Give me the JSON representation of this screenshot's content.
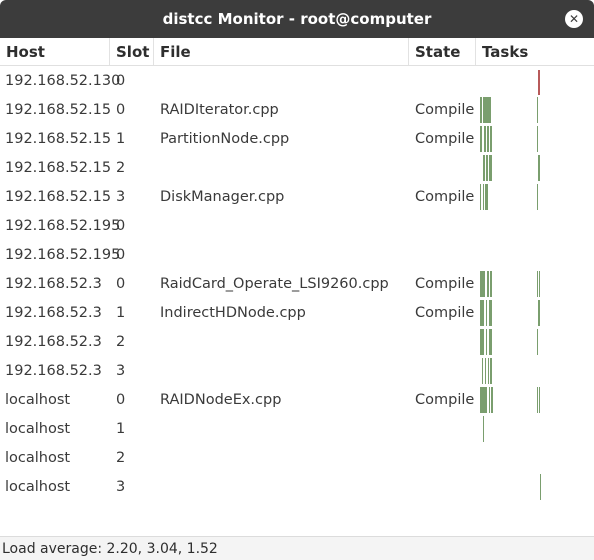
{
  "window": {
    "title": "distcc Monitor - root@computer"
  },
  "columns": {
    "host": "Host",
    "slot": "Slot",
    "file": "File",
    "state": "State",
    "tasks": "Tasks"
  },
  "colors": {
    "compile": "#7a9e6e",
    "error": "#b85a5a",
    "titlebar": "#3c3c3c"
  },
  "rows": [
    {
      "host": "192.168.52.130",
      "slot": "0",
      "file": "",
      "state": ""
    },
    {
      "host": "192.168.52.15",
      "slot": "0",
      "file": "RAIDIterator.cpp",
      "state": "Compile"
    },
    {
      "host": "192.168.52.15",
      "slot": "1",
      "file": "PartitionNode.cpp",
      "state": "Compile"
    },
    {
      "host": "192.168.52.15",
      "slot": "2",
      "file": "",
      "state": ""
    },
    {
      "host": "192.168.52.15",
      "slot": "3",
      "file": "DiskManager.cpp",
      "state": "Compile"
    },
    {
      "host": "192.168.52.195",
      "slot": "0",
      "file": "",
      "state": ""
    },
    {
      "host": "192.168.52.195",
      "slot": "0",
      "file": "",
      "state": ""
    },
    {
      "host": "192.168.52.3",
      "slot": "0",
      "file": "RaidCard_Operate_LSI9260.cpp",
      "state": "Compile"
    },
    {
      "host": "192.168.52.3",
      "slot": "1",
      "file": "IndirectHDNode.cpp",
      "state": "Compile"
    },
    {
      "host": "192.168.52.3",
      "slot": "2",
      "file": "",
      "state": ""
    },
    {
      "host": "192.168.52.3",
      "slot": "3",
      "file": "",
      "state": ""
    },
    {
      "host": "localhost",
      "slot": "0",
      "file": "RAIDNodeEx.cpp",
      "state": "Compile"
    },
    {
      "host": "localhost",
      "slot": "1",
      "file": "",
      "state": ""
    },
    {
      "host": "localhost",
      "slot": "2",
      "file": "",
      "state": ""
    },
    {
      "host": "localhost",
      "slot": "3",
      "file": "",
      "state": ""
    }
  ],
  "status": {
    "load_average": "Load average: 2.20, 3.04, 1.52"
  }
}
